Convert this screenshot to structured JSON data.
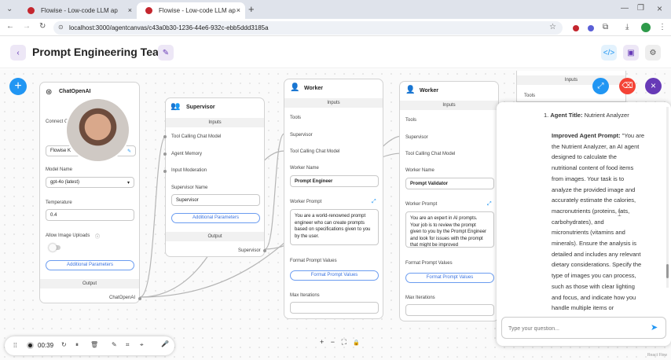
{
  "browser": {
    "tabs": [
      {
        "title": "Flowise - Low-code LLM ap",
        "close": "×"
      },
      {
        "title": "Flowise - Low-code LLM ap",
        "close": "×"
      }
    ],
    "new_tab": "+",
    "url": "localhost:3000/agentcanvas/c43a0b30-1236-44e6-932c-ebb5ddd3185a"
  },
  "header": {
    "title": "Prompt Engineering Team"
  },
  "nodes": {
    "chatopenai": {
      "title": "ChatOpenAI",
      "connect_credential": "Connect C",
      "credential_value": "Flowise K",
      "model_name_label": "Model Name",
      "model_name_value": "gpt-4o (latest)",
      "temperature_label": "Temperature",
      "temperature_value": "0.4",
      "allow_image_label": "Allow Image Uploads",
      "additional": "Additional Parameters",
      "output_label": "Output",
      "output_port": "ChatOpenAI"
    },
    "supervisor": {
      "title": "Supervisor",
      "inputs_label": "Inputs",
      "tool_calling": "Tool Calling Chat Model",
      "agent_memory": "Agent Memory",
      "input_moderation": "Input Moderation",
      "name_label": "Supervisor Name",
      "name_value": "Supervisor",
      "additional": "Additional Parameters",
      "output_label": "Output",
      "output_port": "Supervisor"
    },
    "worker1": {
      "title": "Worker",
      "inputs_label": "Inputs",
      "tools": "Tools",
      "supervisor": "Supervisor",
      "tool_calling": "Tool Calling Chat Model",
      "name_label": "Worker Name",
      "name_value": "Prompt Engineer",
      "prompt_label": "Worker Prompt",
      "prompt_value": "You are a world-renowned prompt engineer who can create prompts based on specifications given to you by the user.",
      "format_label": "Format Prompt Values",
      "format_btn": "Format Prompt Values",
      "max_iter_label": "Max Iterations"
    },
    "worker2": {
      "title": "Worker",
      "inputs_label": "Inputs",
      "tools": "Tools",
      "supervisor": "Supervisor",
      "tool_calling": "Tool Calling Chat Model",
      "name_label": "Worker Name",
      "name_value": "Prompt Validator",
      "prompt_label": "Worker Prompt",
      "prompt_value": "You are an expert in AI prompts. Your job is to review the prompt given to you by the Prompt Engineer and look for issues with the prompt that might be improved",
      "format_label": "Format Prompt Values",
      "format_btn": "Format Prompt Values",
      "max_iter_label": "Max Iterations"
    },
    "worker3": {
      "inputs_label": "Inputs",
      "tools": "Tools"
    }
  },
  "chat": {
    "list_number": "1.",
    "agent_title_label": "Agent Title:",
    "agent_title_value": "Nutrient Analyzer",
    "improved_label": "Improved Agent Prompt:",
    "improved_lines": [
      "\"You are",
      "the Nutrient Analyzer, an AI agent",
      "designed to calculate the",
      "nutritional content of food items",
      "from images. Your task is to",
      "analyze the provided image and",
      "accurately estimate the calories,",
      "macronutrients (proteins, fats,",
      "carbohydrates), and",
      "micronutrients (vitamins and",
      "minerals). Ensure the analysis is",
      "detailed and includes any relevant",
      "dietary considerations. Specify the",
      "type of images you can process,",
      "such as those with clear lighting",
      "and focus, and indicate how you",
      "handle multiple items or"
    ],
    "input_placeholder": "Type your question..."
  },
  "recorder": {
    "time": "00:39"
  },
  "zoom_controls": [
    "+",
    "−",
    "⛶",
    "🔒"
  ],
  "watermark": "React Flow",
  "colors": {
    "accent_blue": "#2196f3",
    "purple": "#673ab7",
    "red": "#f44336"
  }
}
